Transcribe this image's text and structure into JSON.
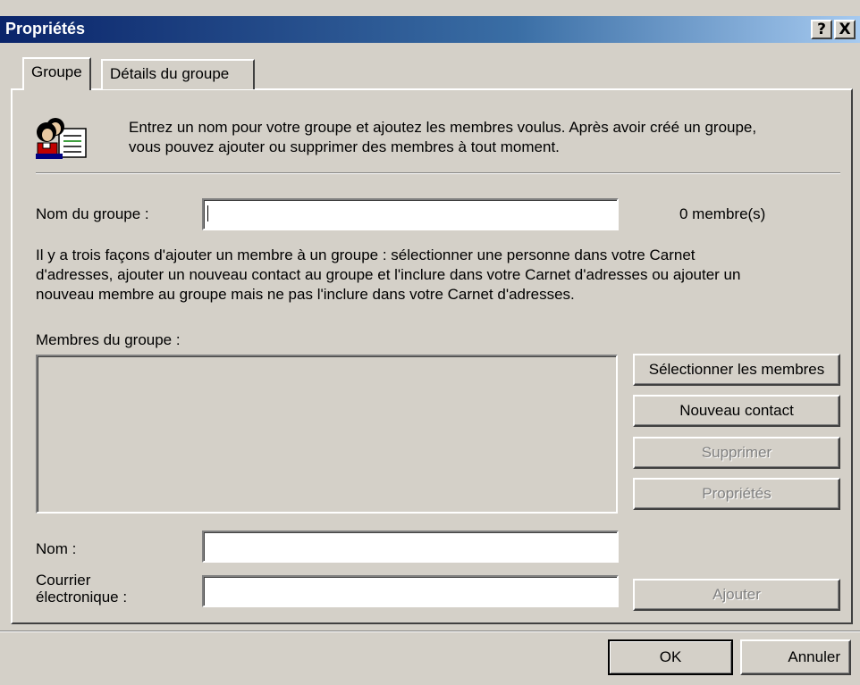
{
  "window": {
    "title": "Propriétés",
    "help_label": "?",
    "close_label": "X"
  },
  "tabs": [
    {
      "label": "Groupe",
      "active": true
    },
    {
      "label": "Détails du groupe",
      "active": false
    }
  ],
  "intro": {
    "icon": "group-contacts-icon",
    "text_line1": "Entrez un nom pour votre groupe et ajoutez les membres voulus. Après avoir créé un groupe,",
    "text_line2": "vous pouvez ajouter ou supprimer des membres à tout moment."
  },
  "group_name": {
    "label": "Nom du groupe :",
    "value": "",
    "member_count": "0 membre(s)"
  },
  "explanation": {
    "line1": "Il y a trois façons d'ajouter un membre à un groupe : sélectionner une personne dans votre Carnet",
    "line2": "d'adresses, ajouter un nouveau contact au groupe et l'inclure dans votre Carnet d'adresses ou ajouter un",
    "line3": "nouveau membre au groupe mais ne pas l'inclure dans votre Carnet d'adresses."
  },
  "members": {
    "label": "Membres du groupe :",
    "items": []
  },
  "side_buttons": {
    "select_members": "Sélectionner les membres",
    "new_contact": "Nouveau contact",
    "delete": "Supprimer",
    "properties": "Propriétés"
  },
  "new_member": {
    "name_label": "Nom :",
    "name_value": "",
    "email_label_line1": "Courrier",
    "email_label_line2": "électronique :",
    "email_value": "",
    "add_label": "Ajouter"
  },
  "footer": {
    "ok_label": "OK",
    "cancel_label": "Annuler"
  },
  "colors": {
    "dialog_bg": "#d4d0c8",
    "titlebar_start": "#0a246a",
    "titlebar_end": "#a6caf0",
    "disabled_text": "#808080"
  }
}
